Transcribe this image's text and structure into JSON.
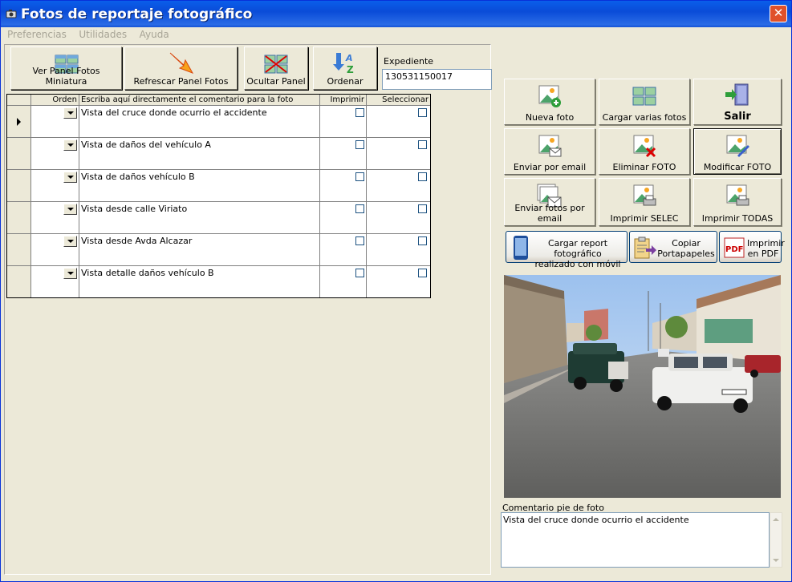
{
  "window": {
    "title": "Fotos de reportaje fotográfico",
    "close": "✕"
  },
  "menu": [
    "Preferencias",
    "Utilidades",
    "Ayuda"
  ],
  "toolbar": {
    "ver_panel": "Ver Panel Fotos Miniatura",
    "refrescar": "Refrescar Panel Fotos",
    "ocultar": "Ocultar Panel",
    "ordenar": "Ordenar"
  },
  "expediente": {
    "label": "Expediente",
    "value": "130531150017"
  },
  "grid": {
    "headers": {
      "orden": "Orden",
      "comentario": "Escriba aquí directamente el comentario para la foto",
      "imprimir": "Imprimir",
      "seleccionar": "Seleccionar"
    },
    "rows": [
      {
        "comentario": "Vista del cruce donde ocurrio el accidente"
      },
      {
        "comentario": "Vista de daños del vehículo A"
      },
      {
        "comentario": "Vista de daños vehículo B"
      },
      {
        "comentario": "Vista desde calle Viriato"
      },
      {
        "comentario": "Vista desde Avda Alcazar"
      },
      {
        "comentario": "Vista  detalle daños vehículo B"
      }
    ]
  },
  "actions": {
    "nueva": "Nueva foto",
    "cargar_varias": "Cargar varias fotos",
    "salir": "Salir",
    "email": "Enviar por email",
    "eliminar": "Eliminar FOTO",
    "modificar": "Modificar FOTO",
    "email_fotos": "Enviar fotos por email",
    "imprimir_selec": "Imprimir SELEC",
    "imprimir_todas": "Imprimir TODAS"
  },
  "extra": {
    "movil_1": "Cargar report fotográfico",
    "movil_2": "realizado con móvil",
    "copiar_1": "Copiar",
    "copiar_2": "Portapapeles",
    "pdf_1": "Imprimir",
    "pdf_2": "en PDF",
    "pdf_badge": "PDF"
  },
  "caption": {
    "label": "Comentario pie de foto",
    "value": "Vista del cruce donde ocurrio el accidente"
  },
  "colors": {
    "title_bar": "#0A5EEA",
    "face": "#ECE9D8",
    "close": "#E0512A"
  }
}
